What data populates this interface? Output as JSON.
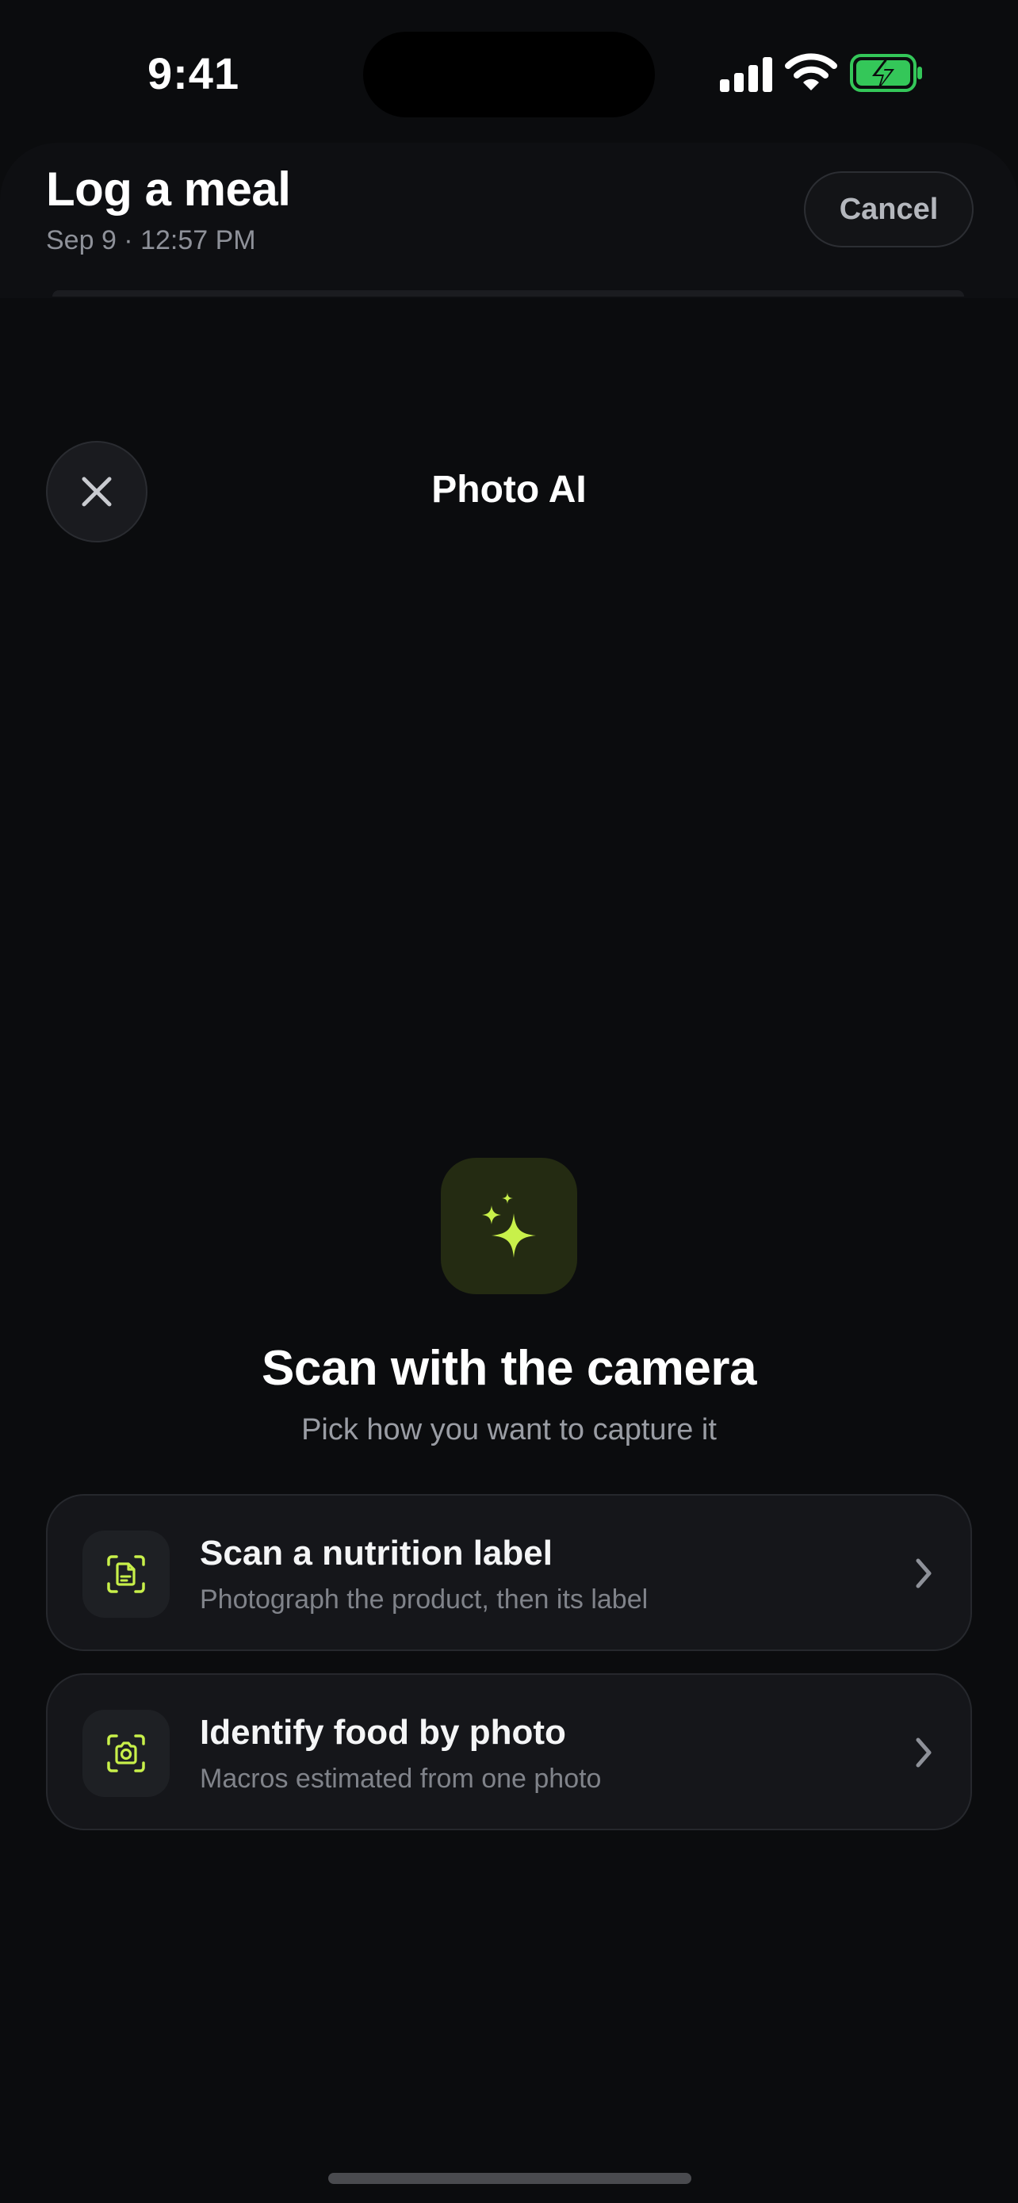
{
  "status_bar": {
    "time": "9:41",
    "icons": [
      "signal-icon",
      "wifi-icon",
      "battery-charging-icon"
    ],
    "battery_color": "#34c759"
  },
  "sheet": {
    "title": "Log a meal",
    "subtitle": "Sep 9 · 12:57 PM",
    "cancel_label": "Cancel"
  },
  "overlay": {
    "title": "Photo AI",
    "close_icon": "close-icon",
    "hero_icon": "sparkles-icon",
    "heading": "Scan with the camera",
    "subheading": "Pick how you want to capture it",
    "options": [
      {
        "title": "Scan a nutrition label",
        "description": "Photograph the product, then its label",
        "icon": "scan-document-icon"
      },
      {
        "title": "Identify food by photo",
        "description": "Macros estimated from one photo",
        "icon": "scan-camera-icon"
      }
    ]
  },
  "colors": {
    "accent": "#c8f04a",
    "accent_tile": "#242b12",
    "background": "#0b0c0e",
    "card": "#15161a"
  }
}
